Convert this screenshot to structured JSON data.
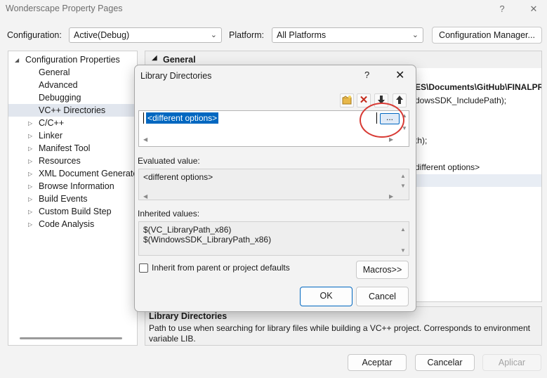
{
  "window": {
    "title": "Wonderscape Property Pages",
    "help": "?",
    "close": "✕"
  },
  "config_bar": {
    "configuration_label": "Configuration:",
    "configuration_value": "Active(Debug)",
    "platform_label": "Platform:",
    "platform_value": "All Platforms",
    "manager_button": "Configuration Manager..."
  },
  "tree": {
    "root": "Configuration Properties",
    "items": [
      {
        "label": "General",
        "expandable": false
      },
      {
        "label": "Advanced",
        "expandable": false
      },
      {
        "label": "Debugging",
        "expandable": false
      },
      {
        "label": "VC++ Directories",
        "expandable": false,
        "selected": true
      },
      {
        "label": "C/C++",
        "expandable": true
      },
      {
        "label": "Linker",
        "expandable": true
      },
      {
        "label": "Manifest Tool",
        "expandable": true
      },
      {
        "label": "Resources",
        "expandable": true
      },
      {
        "label": "XML Document Generator",
        "expandable": true
      },
      {
        "label": "Browse Information",
        "expandable": true
      },
      {
        "label": "Build Events",
        "expandable": true
      },
      {
        "label": "Custom Build Step",
        "expandable": true
      },
      {
        "label": "Code Analysis",
        "expandable": true
      }
    ]
  },
  "grid": {
    "section": "General",
    "rows": [
      "ES\\Documents\\GitHub\\FINALPR",
      "dowsSDK_IncludePath);",
      "th);",
      "different options>"
    ]
  },
  "description": {
    "title": "Library Directories",
    "text": "Path to use when searching for library files while building a VC++ project.  Corresponds to environment variable LIB."
  },
  "footer": {
    "accept": "Aceptar",
    "cancel": "Cancelar",
    "apply": "Aplicar"
  },
  "dialog": {
    "title": "Library Directories",
    "help": "?",
    "close": "✕",
    "entry_value": "<different options>",
    "ellipsis_button": "...",
    "evaluated_label": "Evaluated value:",
    "evaluated_value": "<different options>",
    "inherited_label": "Inherited values:",
    "inherited_values": [
      "$(VC_LibraryPath_x86)",
      "$(WindowsSDK_LibraryPath_x86)"
    ],
    "inherit_checkbox": "Inherit from parent or project defaults",
    "inherit_checked": false,
    "macros_button": "Macros>>",
    "ok_button": "OK",
    "cancel_button": "Cancel"
  },
  "colors": {
    "accent": "#0067c0",
    "annotation": "#d83a34"
  }
}
